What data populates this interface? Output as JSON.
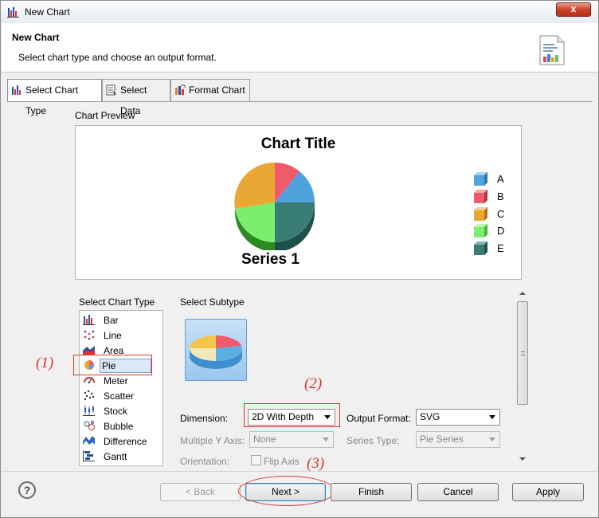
{
  "window": {
    "title": "New Chart",
    "close_label": "x"
  },
  "header": {
    "title": "New Chart",
    "description": "Select chart type and choose an output format."
  },
  "tabs": [
    {
      "label": "Select Chart Type",
      "active": true
    },
    {
      "label": "Select Data",
      "active": false
    },
    {
      "label": "Format Chart",
      "active": false
    }
  ],
  "preview": {
    "label": "Chart Preview",
    "chart_title": "Chart Title",
    "series_title": "Series 1",
    "legend": [
      {
        "label": "A",
        "color": "#4fa3dc"
      },
      {
        "label": "B",
        "color": "#ef5a6c"
      },
      {
        "label": "C",
        "color": "#eaa733"
      },
      {
        "label": "D",
        "color": "#7cee6f"
      },
      {
        "label": "E",
        "color": "#3a7c76"
      }
    ]
  },
  "chart_data": {
    "type": "pie",
    "title": "Chart Title",
    "series": [
      {
        "name": "Series 1",
        "categories": [
          "A",
          "B",
          "C",
          "D",
          "E"
        ]
      }
    ],
    "legend_position": "right"
  },
  "chart_types": {
    "label": "Select Chart Type",
    "items": [
      {
        "label": "Bar",
        "icon": "bar-chart-icon"
      },
      {
        "label": "Line",
        "icon": "line-chart-icon"
      },
      {
        "label": "Area",
        "icon": "area-chart-icon"
      },
      {
        "label": "Pie",
        "icon": "pie-chart-icon",
        "selected": true
      },
      {
        "label": "Meter",
        "icon": "meter-chart-icon"
      },
      {
        "label": "Scatter",
        "icon": "scatter-chart-icon"
      },
      {
        "label": "Stock",
        "icon": "stock-chart-icon"
      },
      {
        "label": "Bubble",
        "icon": "bubble-chart-icon"
      },
      {
        "label": "Difference",
        "icon": "difference-chart-icon"
      },
      {
        "label": "Gantt",
        "icon": "gantt-chart-icon"
      }
    ]
  },
  "subtype": {
    "label": "Select Subtype"
  },
  "options": {
    "dimension_label": "Dimension:",
    "dimension_value": "2D With Depth",
    "output_format_label": "Output Format:",
    "output_format_value": "SVG",
    "multiple_y_label": "Multiple Y Axis:",
    "multiple_y_value": "None",
    "series_type_label": "Series Type:",
    "series_type_value": "Pie Series",
    "orientation_label": "Orientation:",
    "flip_axis_label": "Flip Axis"
  },
  "annotations": {
    "one": "(1)",
    "two": "(2)",
    "three": "(3)"
  },
  "footer": {
    "help": "?",
    "back": "< Back",
    "next": "Next >",
    "finish": "Finish",
    "cancel": "Cancel",
    "apply": "Apply"
  }
}
